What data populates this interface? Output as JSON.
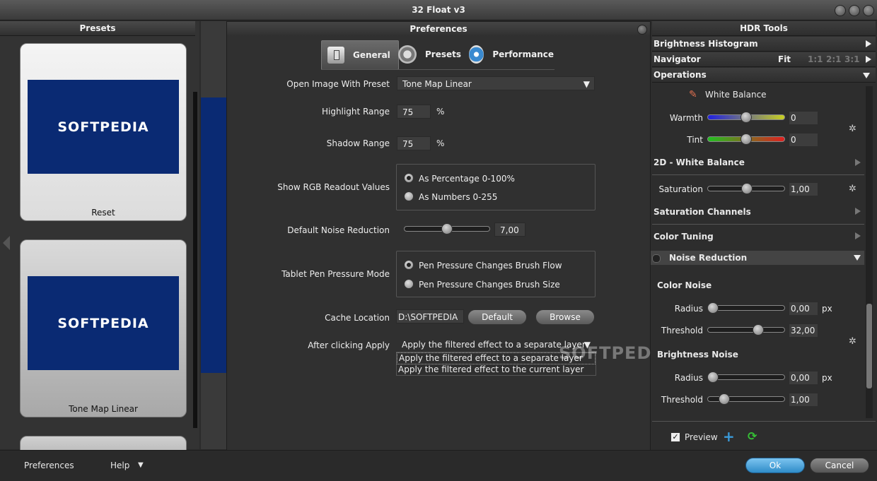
{
  "window": {
    "title": "32 Float v3"
  },
  "presets_panel": {
    "title": "Presets",
    "cards": [
      {
        "thumb_text": "SOFTPEDIA",
        "label": "Reset"
      },
      {
        "thumb_text": "SOFTPEDIA",
        "label": "Tone Map Linear"
      }
    ]
  },
  "bottom": {
    "preferences": "Preferences",
    "help": "Help",
    "ok": "Ok",
    "cancel": "Cancel"
  },
  "prefs": {
    "title": "Preferences",
    "tabs": [
      {
        "label": "General",
        "icon": "switch-icon"
      },
      {
        "label": "Presets",
        "icon": "gear-icon"
      },
      {
        "label": "Performance",
        "icon": "compass-icon"
      }
    ],
    "open_image_label": "Open Image With Preset",
    "open_image_value": "Tone Map Linear",
    "highlight_label": "Highlight Range",
    "highlight_value": "75",
    "shadow_label": "Shadow Range",
    "shadow_value": "75",
    "percent": "%",
    "rgb_label": "Show RGB Readout Values",
    "rgb_options": [
      "As Percentage 0-100%",
      "As Numbers 0-255"
    ],
    "rgb_selected": 0,
    "noise_label": "Default Noise Reduction",
    "noise_value": "7,00",
    "noise_fraction": 0.5,
    "tablet_label": "Tablet Pen Pressure Mode",
    "tablet_options": [
      "Pen Pressure Changes Brush Flow",
      "Pen Pressure Changes Brush Size"
    ],
    "tablet_selected": 0,
    "cache_label": "Cache Location",
    "cache_value": "D:\\SOFTPEDIA",
    "default_btn": "Default",
    "browse_btn": "Browse",
    "after_label": "After clicking Apply",
    "after_value": "Apply the filtered effect to a separate layer",
    "after_options": [
      "Apply the filtered effect to a separate layer",
      "Apply the filtered effect to the current layer"
    ],
    "watermark": "SOFTPEDIA"
  },
  "hdr": {
    "title": "HDR Tools",
    "brightness_histogram": "Brightness Histogram",
    "navigator": "Navigator",
    "nav_fit": "Fit",
    "nav_zooms": [
      "1:1",
      "2:1",
      "3:1"
    ],
    "operations": "Operations",
    "white_balance": "White Balance",
    "warmth_label": "Warmth",
    "warmth_value": "0",
    "tint_label": "Tint",
    "tint_value": "0",
    "wb2d": "2D - White Balance",
    "saturation_label": "Saturation",
    "saturation_value": "1,00",
    "saturation_channels": "Saturation Channels",
    "color_tuning": "Color Tuning",
    "noise_reduction": "Noise Reduction",
    "color_noise": "Color Noise",
    "cn_radius_label": "Radius",
    "cn_radius_value": "0,00",
    "cn_threshold_label": "Threshold",
    "cn_threshold_value": "32,00",
    "brightness_noise": "Brightness Noise",
    "bn_radius_label": "Radius",
    "bn_radius_value": "0,00",
    "bn_threshold_label": "Threshold",
    "bn_threshold_value": "1,00",
    "px": "px",
    "preview_label": "Preview",
    "colors": {
      "accent_blue": "#3a9ad9",
      "ok_blue": "#4aa3e0"
    }
  }
}
